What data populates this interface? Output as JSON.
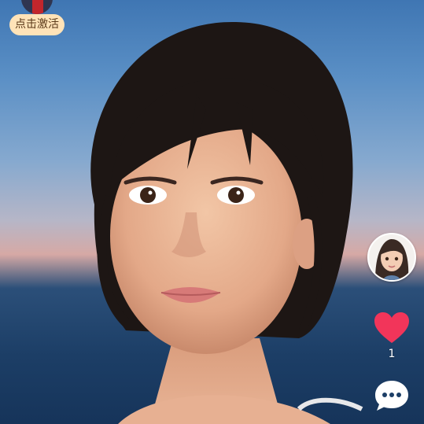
{
  "activate": {
    "label": "点击激活"
  },
  "creator": {
    "avatar_icon": "cartoon-girl-avatar"
  },
  "actions": {
    "like_icon": "heart-icon",
    "like_count": "1",
    "comment_icon": "comment-icon"
  },
  "colors": {
    "activate_pill_bg": "#ffe3b8",
    "heart": "#f2355a",
    "sky": "#4f86c0",
    "sea": "#1c3e66"
  }
}
